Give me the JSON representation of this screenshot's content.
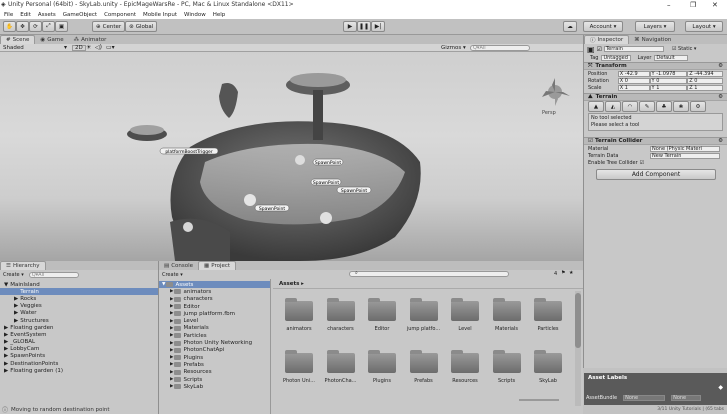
{
  "window": {
    "title": "Unity Personal (64bit) - SkyLab.unity - EpicMageWarsRe - PC, Mac & Linux Standalone <DX11>",
    "minimize": "–",
    "maximize": "❐",
    "close": "✕"
  },
  "menu": [
    "File",
    "Edit",
    "Assets",
    "GameObject",
    "Component",
    "Mobile Input",
    "Window",
    "Help"
  ],
  "toolbar": {
    "center": "Center",
    "global": "Global",
    "account": "Account",
    "layers": "Layers",
    "layout": "Layout"
  },
  "scene": {
    "tabs": [
      "Scene",
      "Game",
      "Animator"
    ],
    "shading": "Shaded",
    "mode_2d": "2D",
    "gizmos": "Gizmos",
    "search_placeholder": "Q▾All",
    "labels": [
      "SpawnPoint",
      "SpawnPoint",
      "SpawnPoint",
      "SpawnPoint",
      "platformBoostTrigger"
    ],
    "persp": "Persp"
  },
  "inspector": {
    "tabs": [
      "Inspector",
      "Navigation"
    ],
    "object_name": "Terrain",
    "static_label": "Static",
    "tag_label": "Tag",
    "tag_value": "Untagged",
    "layer_label": "Layer",
    "layer_value": "Default",
    "transform": {
      "header": "Transform",
      "position_label": "Position",
      "rotation_label": "Rotation",
      "scale_label": "Scale",
      "position": [
        "X -42.9",
        "Y -1.0978",
        "Z -44.394"
      ],
      "rotation": [
        "X 0",
        "Y 0",
        "Z 0"
      ],
      "scale": [
        "X 1",
        "Y 1",
        "Z 1"
      ]
    },
    "terrain": {
      "header": "Terrain",
      "no_tool": "No tool selected",
      "select_tool": "Please select a tool"
    },
    "terrain_collider": {
      "header": "Terrain Collider",
      "material_label": "Material",
      "material_value": "None (Physic Materi",
      "data_label": "Terrain Data",
      "data_value": "New Terrain",
      "trees_label": "Enable Tree Collider"
    },
    "add_component": "Add Component",
    "asset_labels": "Asset Labels",
    "asset_bundle_label": "AssetBundle",
    "asset_bundle_value": "None",
    "asset_bundle_variant": "None"
  },
  "hierarchy": {
    "tab": "Hierarchy",
    "create": "Create",
    "search_placeholder": "Q▾All",
    "items": [
      {
        "label": "MainIsland",
        "indent": 0,
        "expanded": true
      },
      {
        "label": "Terrain",
        "indent": 1,
        "selected": true
      },
      {
        "label": "Rocks",
        "indent": 1
      },
      {
        "label": "Veggies",
        "indent": 1
      },
      {
        "label": "Water",
        "indent": 1
      },
      {
        "label": "Structures",
        "indent": 1
      },
      {
        "label": "Floating garden",
        "indent": 0
      },
      {
        "label": "EventSystem",
        "indent": 0
      },
      {
        "label": "_GLOBAL",
        "indent": 0
      },
      {
        "label": "LobbyCam",
        "indent": 0
      },
      {
        "label": "SpawnPoints",
        "indent": 0
      },
      {
        "label": "DestinationPoints",
        "indent": 0
      },
      {
        "label": "Floating garden (1)",
        "indent": 0
      }
    ]
  },
  "project": {
    "tabs": [
      "Console",
      "Project"
    ],
    "create": "Create",
    "breadcrumb": "Assets",
    "count": "4",
    "tree": [
      {
        "label": "Assets",
        "indent": 0,
        "selected": true
      },
      {
        "label": "animators",
        "indent": 1
      },
      {
        "label": "characters",
        "indent": 1
      },
      {
        "label": "Editor",
        "indent": 1
      },
      {
        "label": "jump platform.fbm",
        "indent": 1
      },
      {
        "label": "Level",
        "indent": 1
      },
      {
        "label": "Materials",
        "indent": 1
      },
      {
        "label": "Particles",
        "indent": 1
      },
      {
        "label": "Photon Unity Networking",
        "indent": 1
      },
      {
        "label": "PhotonChatApi",
        "indent": 1
      },
      {
        "label": "Plugins",
        "indent": 1
      },
      {
        "label": "Prefabs",
        "indent": 1
      },
      {
        "label": "Resources",
        "indent": 1
      },
      {
        "label": "Scripts",
        "indent": 1
      },
      {
        "label": "SkyLab",
        "indent": 1
      }
    ],
    "grid_row1": [
      "animators",
      "characters",
      "Editor",
      "jump platfo...",
      "Level",
      "Materials",
      "Particles"
    ],
    "grid_row2": [
      "Photon Uni...",
      "PhotonCha...",
      "Plugins",
      "Prefabs",
      "Resources",
      "Scripts",
      "SkyLab"
    ]
  },
  "status": {
    "message": "Moving to random destination point",
    "fps": "3/11  Unity Tutorials  |  (65 tabs"
  }
}
